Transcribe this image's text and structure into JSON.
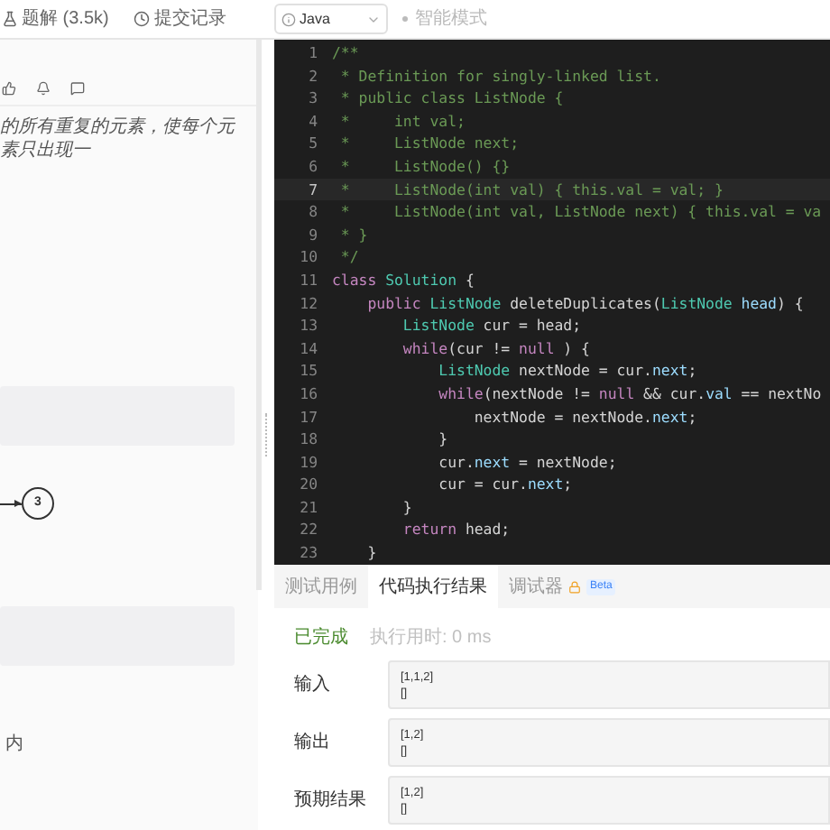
{
  "top_bar": {
    "tabs": [
      {
        "label": "题解 (3.5k)"
      },
      {
        "label": "提交记录"
      }
    ],
    "language_select": {
      "value": "Java"
    },
    "smart_mode": {
      "label": "智能模式",
      "disabled": true
    }
  },
  "description": {
    "text": "的所有重复的元素，使每个元素只出现一",
    "diagram_node": "3",
    "footer_text": "内"
  },
  "editor": {
    "lines": [
      {
        "number": "1",
        "current": false,
        "segments": [
          {
            "kind": "comment",
            "text": "/**"
          }
        ]
      },
      {
        "number": "2",
        "current": false,
        "segments": [
          {
            "kind": "comment",
            "text": " * Definition for singly-linked list."
          }
        ]
      },
      {
        "number": "3",
        "current": false,
        "segments": [
          {
            "kind": "comment",
            "text": " * public class ListNode {"
          }
        ]
      },
      {
        "number": "4",
        "current": false,
        "segments": [
          {
            "kind": "comment",
            "text": " *     int val;"
          }
        ]
      },
      {
        "number": "5",
        "current": false,
        "segments": [
          {
            "kind": "comment",
            "text": " *     ListNode next;"
          }
        ]
      },
      {
        "number": "6",
        "current": false,
        "segments": [
          {
            "kind": "comment",
            "text": " *     ListNode() {}"
          }
        ]
      },
      {
        "number": "7",
        "current": true,
        "segments": [
          {
            "kind": "comment",
            "text": " *     ListNode(int val) { this.val = val; }"
          }
        ]
      },
      {
        "number": "8",
        "current": false,
        "segments": [
          {
            "kind": "comment",
            "text": " *     ListNode(int val, ListNode next) { this.val = va"
          }
        ]
      },
      {
        "number": "9",
        "current": false,
        "segments": [
          {
            "kind": "comment",
            "text": " * }"
          }
        ]
      },
      {
        "number": "10",
        "current": false,
        "segments": [
          {
            "kind": "comment",
            "text": " */"
          }
        ]
      },
      {
        "number": "11",
        "current": false,
        "segments": [
          {
            "kind": "keyword",
            "text": "class "
          },
          {
            "kind": "type",
            "text": "Solution"
          },
          {
            "kind": "plain",
            "text": " {"
          }
        ]
      },
      {
        "number": "12",
        "current": false,
        "segments": [
          {
            "kind": "keyword",
            "text": "    public "
          },
          {
            "kind": "type",
            "text": "ListNode"
          },
          {
            "kind": "plain",
            "text": " deleteDuplicates("
          },
          {
            "kind": "type",
            "text": "ListNode"
          },
          {
            "kind": "var",
            "text": " head"
          },
          {
            "kind": "plain",
            "text": ") {"
          }
        ]
      },
      {
        "number": "13",
        "current": false,
        "segments": [
          {
            "kind": "type",
            "text": "        ListNode"
          },
          {
            "kind": "plain",
            "text": " cur = head;"
          }
        ]
      },
      {
        "number": "14",
        "current": false,
        "segments": [
          {
            "kind": "keyword",
            "text": "        while"
          },
          {
            "kind": "plain",
            "text": "(cur != "
          },
          {
            "kind": "keyword",
            "text": "null"
          },
          {
            "kind": "plain",
            "text": " ) {"
          }
        ]
      },
      {
        "number": "15",
        "current": false,
        "segments": [
          {
            "kind": "type",
            "text": "            ListNode"
          },
          {
            "kind": "plain",
            "text": " nextNode = cur."
          },
          {
            "kind": "var",
            "text": "next"
          },
          {
            "kind": "plain",
            "text": ";"
          }
        ]
      },
      {
        "number": "16",
        "current": false,
        "segments": [
          {
            "kind": "keyword",
            "text": "            while"
          },
          {
            "kind": "plain",
            "text": "(nextNode != "
          },
          {
            "kind": "keyword",
            "text": "null"
          },
          {
            "kind": "plain",
            "text": " && cur."
          },
          {
            "kind": "var",
            "text": "val"
          },
          {
            "kind": "plain",
            "text": " == nextNo"
          }
        ]
      },
      {
        "number": "17",
        "current": false,
        "segments": [
          {
            "kind": "plain",
            "text": "                nextNode = nextNode."
          },
          {
            "kind": "var",
            "text": "next"
          },
          {
            "kind": "plain",
            "text": ";"
          }
        ]
      },
      {
        "number": "18",
        "current": false,
        "segments": [
          {
            "kind": "plain",
            "text": "            }"
          }
        ]
      },
      {
        "number": "19",
        "current": false,
        "segments": [
          {
            "kind": "plain",
            "text": "            cur."
          },
          {
            "kind": "var",
            "text": "next"
          },
          {
            "kind": "plain",
            "text": " = nextNode;"
          }
        ]
      },
      {
        "number": "20",
        "current": false,
        "segments": [
          {
            "kind": "plain",
            "text": "            cur = cur."
          },
          {
            "kind": "var",
            "text": "next"
          },
          {
            "kind": "plain",
            "text": ";"
          }
        ]
      },
      {
        "number": "21",
        "current": false,
        "segments": [
          {
            "kind": "plain",
            "text": "        }"
          }
        ]
      },
      {
        "number": "22",
        "current": false,
        "segments": [
          {
            "kind": "keyword",
            "text": "        return"
          },
          {
            "kind": "plain",
            "text": " head;"
          }
        ]
      },
      {
        "number": "23",
        "current": false,
        "segments": [
          {
            "kind": "plain",
            "text": "    }"
          }
        ]
      }
    ]
  },
  "result_panel": {
    "tabs": [
      {
        "label": "测试用例",
        "selected": false
      },
      {
        "label": "代码执行结果",
        "selected": true
      },
      {
        "label": "调试器",
        "selected": false,
        "locked": true,
        "badge": "Beta"
      }
    ],
    "status": "已完成",
    "runtime": "执行用时: 0 ms",
    "rows": [
      {
        "label": "输入",
        "lines": [
          "[1,1,2]",
          "[]"
        ]
      },
      {
        "label": "输出",
        "lines": [
          "[1,2]",
          "[]"
        ]
      },
      {
        "label": "预期结果",
        "lines": [
          "[1,2]",
          "[]"
        ]
      }
    ]
  }
}
